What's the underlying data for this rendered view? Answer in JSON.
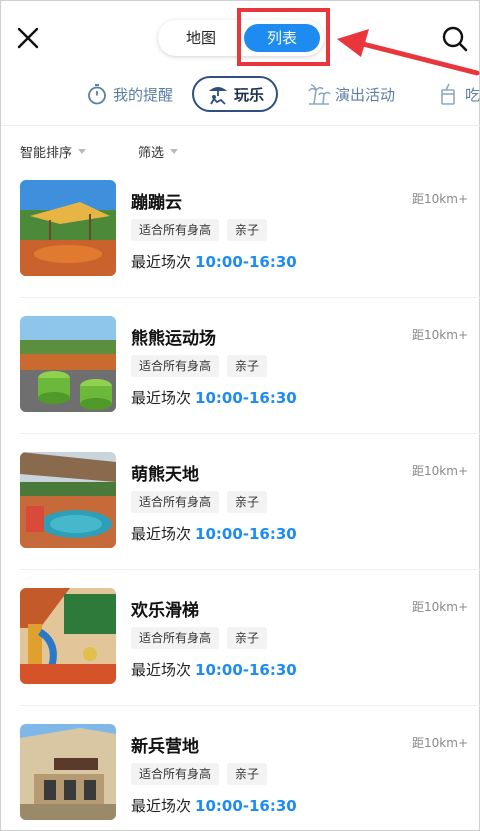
{
  "header": {
    "map_label": "地图",
    "list_label": "列表"
  },
  "categories": [
    {
      "label": "我的提醒",
      "icon": "stopwatch-icon"
    },
    {
      "label": "玩乐",
      "icon": "umbrella-person-icon",
      "active": true
    },
    {
      "label": "演出活动",
      "icon": "palm-trees-icon"
    },
    {
      "label": "吃",
      "icon": "drink-cup-icon"
    }
  ],
  "sortbar": {
    "sort_label": "智能排序",
    "filter_label": "筛选"
  },
  "items": [
    {
      "name": "蹦蹦云",
      "distance": "距10km+",
      "tags": [
        "适合所有身高",
        "亲子"
      ],
      "session_label": "最近场次",
      "time": "10:00-16:30"
    },
    {
      "name": "熊熊运动场",
      "distance": "距10km+",
      "tags": [
        "适合所有身高",
        "亲子"
      ],
      "session_label": "最近场次",
      "time": "10:00-16:30"
    },
    {
      "name": "萌熊天地",
      "distance": "距10km+",
      "tags": [
        "适合所有身高",
        "亲子"
      ],
      "session_label": "最近场次",
      "time": "10:00-16:30"
    },
    {
      "name": "欢乐滑梯",
      "distance": "距10km+",
      "tags": [
        "适合所有身高",
        "亲子"
      ],
      "session_label": "最近场次",
      "time": "10:00-16:30"
    },
    {
      "name": "新兵营地",
      "distance": "距10km+",
      "tags": [
        "适合所有身高",
        "亲子"
      ],
      "session_label": "最近场次",
      "time": "10:00-16:30"
    }
  ],
  "colors": {
    "accent": "#1e8bf0",
    "annotation": "#e8363c",
    "category_text": "#5b7fa6"
  }
}
